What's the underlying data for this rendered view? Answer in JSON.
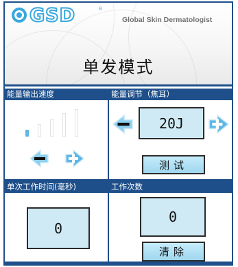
{
  "header": {
    "logo_text": "GSD",
    "logo_reg": "®",
    "slogan": "Global Skin Dermatologist",
    "title": "单发模式"
  },
  "panels": {
    "speed": {
      "label": "能量输出速度",
      "level": 1,
      "max_level": 5
    },
    "energy": {
      "label": "能量调节（焦耳）",
      "value": "20J",
      "test_button": "测试"
    },
    "time": {
      "label": "单次工作时间(毫秒)",
      "value": "0"
    },
    "count": {
      "label": "工作次数",
      "value": "0",
      "clear_button": "清除"
    }
  },
  "icons": {
    "decrease": "minus-left-arrow-icon",
    "increase": "plus-right-arrow-icon"
  },
  "colors": {
    "accent": "#1e4f8a",
    "arrow_blue": "#5db8e6",
    "value_bg": "#cfeaf5"
  }
}
